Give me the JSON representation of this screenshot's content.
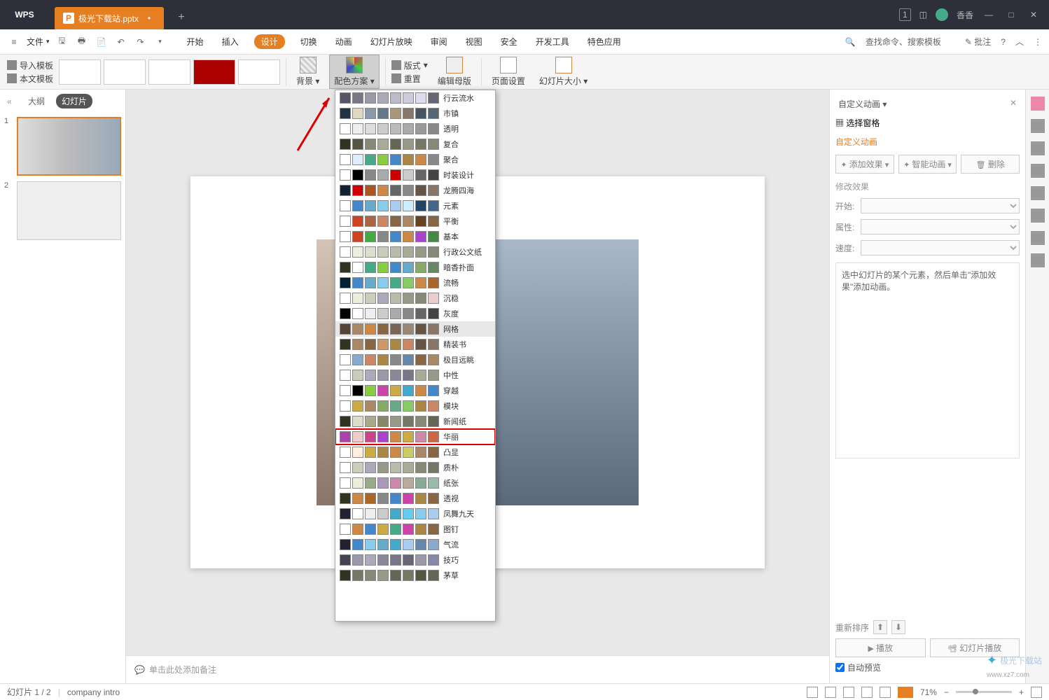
{
  "titlebar": {
    "logo": "WPS",
    "tab_icon": "P",
    "tab_name": "极光下载站.pptx",
    "plus": "+",
    "badge": "1",
    "user": "香香"
  },
  "menubar": {
    "hamburger": "≡",
    "file": "文件",
    "tabs": [
      "开始",
      "插入",
      "设计",
      "切换",
      "动画",
      "幻灯片放映",
      "审阅",
      "视图",
      "安全",
      "开发工具",
      "特色应用"
    ],
    "active_tab": "设计",
    "search": "查找命令、搜索模板",
    "批注": "批注"
  },
  "toolbar": {
    "import_template": "导入模板",
    "this_template": "本文模板",
    "background": "背景",
    "color_scheme": "配色方案",
    "layout": "版式",
    "reset": "重置",
    "edit_master": "编辑母版",
    "page_setup": "页面设置",
    "slide_size": "幻灯片大小"
  },
  "left_panel": {
    "outline": "大纲",
    "slides": "幻灯片",
    "collapse": "«"
  },
  "notes": {
    "placeholder": "单击此处添加备注"
  },
  "right_panel": {
    "title": "自定义动画",
    "select_pane": "选择窗格",
    "custom_anim": "自定义动画",
    "add_effect": "添加效果",
    "smart_anim": "智能动画",
    "delete": "删除",
    "modify": "修改效果",
    "start": "开始:",
    "property": "属性:",
    "speed": "速度:",
    "hint": "选中幻灯片的某个元素，然后单击\"添加效果\"添加动画。",
    "reorder": "重新排序",
    "play": "播放",
    "slideshow": "幻灯片播放",
    "auto_preview": "自动预览"
  },
  "statusbar": {
    "slide_info": "幻灯片 1 / 2",
    "field2": "company intro",
    "zoom": "71%"
  },
  "color_schemes": [
    {
      "name": "行云流水",
      "colors": [
        "#556",
        "#778",
        "#99a",
        "#aab",
        "#bbc",
        "#ccd",
        "#dde",
        "#667"
      ]
    },
    {
      "name": "市镇",
      "colors": [
        "#234",
        "#e0d8c0",
        "#8899aa",
        "#667788",
        "#a89878",
        "#887766",
        "#445566",
        "#556677"
      ]
    },
    {
      "name": "透明",
      "colors": [
        "#fff",
        "#eee",
        "#ddd",
        "#ccc",
        "#bbb",
        "#aaa",
        "#999",
        "#888"
      ]
    },
    {
      "name": "复合",
      "colors": [
        "#332",
        "#554",
        "#887",
        "#aa9",
        "#665",
        "#998",
        "#776",
        "#887"
      ]
    },
    {
      "name": "聚合",
      "colors": [
        "#fff",
        "#def",
        "#4a8",
        "#8c4",
        "#48c",
        "#a84",
        "#c84",
        "#888"
      ]
    },
    {
      "name": "时装设计",
      "colors": [
        "#fff",
        "#000",
        "#888",
        "#aaa",
        "#c00",
        "#ccc",
        "#666",
        "#444"
      ]
    },
    {
      "name": "龙腾四海",
      "colors": [
        "#123",
        "#c00",
        "#a52",
        "#c84",
        "#666",
        "#888",
        "#654",
        "#876"
      ]
    },
    {
      "name": "元素",
      "colors": [
        "#fff",
        "#48c",
        "#6ac",
        "#8ce",
        "#ace",
        "#cef",
        "#246",
        "#468"
      ]
    },
    {
      "name": "平衡",
      "colors": [
        "#fff",
        "#c42",
        "#a64",
        "#c86",
        "#864",
        "#a86",
        "#642",
        "#864"
      ]
    },
    {
      "name": "基本",
      "colors": [
        "#fff",
        "#c42",
        "#4a4",
        "#888",
        "#48c",
        "#c84",
        "#a4c",
        "#484"
      ]
    },
    {
      "name": "行政公文纸",
      "colors": [
        "#fff",
        "#eed",
        "#ddc",
        "#ccb",
        "#bba",
        "#aa9",
        "#998",
        "#887"
      ]
    },
    {
      "name": "暗香扑面",
      "colors": [
        "#332",
        "#fff",
        "#4a8",
        "#8c4",
        "#48c",
        "#6ac",
        "#8a6",
        "#686"
      ]
    },
    {
      "name": "流畅",
      "colors": [
        "#023",
        "#48c",
        "#6ac",
        "#8ce",
        "#4a8",
        "#8c6",
        "#c84",
        "#a62"
      ]
    },
    {
      "name": "沉稳",
      "colors": [
        "#fff",
        "#eed",
        "#ccb",
        "#aab",
        "#bba",
        "#998",
        "#887",
        "#ecc"
      ]
    },
    {
      "name": "灰度",
      "colors": [
        "#000",
        "#fff",
        "#eee",
        "#ccc",
        "#aaa",
        "#888",
        "#666",
        "#444"
      ]
    },
    {
      "name": "网格",
      "colors": [
        "#543",
        "#a86",
        "#c84",
        "#864",
        "#765",
        "#987",
        "#654",
        "#876"
      ],
      "highlighted": true
    },
    {
      "name": "精装书",
      "colors": [
        "#332",
        "#a86",
        "#864",
        "#c96",
        "#a84",
        "#c86",
        "#654",
        "#876"
      ]
    },
    {
      "name": "极目远眺",
      "colors": [
        "#fff",
        "#8ac",
        "#c86",
        "#a84",
        "#888",
        "#68a",
        "#864",
        "#a86"
      ]
    },
    {
      "name": "中性",
      "colors": [
        "#fff",
        "#ccb",
        "#aab",
        "#99a",
        "#889",
        "#778",
        "#aa9",
        "#998"
      ]
    },
    {
      "name": "穿越",
      "colors": [
        "#fff",
        "#000",
        "#8c4",
        "#c4a",
        "#ca4",
        "#4ac",
        "#c84",
        "#48c"
      ]
    },
    {
      "name": "模块",
      "colors": [
        "#fff",
        "#ca4",
        "#a86",
        "#8a6",
        "#6a8",
        "#8c6",
        "#a84",
        "#c86"
      ]
    },
    {
      "name": "新闻纸",
      "colors": [
        "#332",
        "#ddc",
        "#aa8",
        "#886",
        "#998",
        "#776",
        "#887",
        "#665"
      ]
    },
    {
      "name": "华丽",
      "colors": [
        "#a4a",
        "#ecc",
        "#c48",
        "#a4c",
        "#c84",
        "#ca4",
        "#c8a",
        "#c64"
      ],
      "red_box": true
    },
    {
      "name": "凸显",
      "colors": [
        "#fff",
        "#fed",
        "#ca4",
        "#a84",
        "#c84",
        "#cc6",
        "#a86",
        "#864"
      ]
    },
    {
      "name": "质朴",
      "colors": [
        "#fff",
        "#ccb",
        "#aab",
        "#998",
        "#bba",
        "#aa9",
        "#887",
        "#776"
      ]
    },
    {
      "name": "纸张",
      "colors": [
        "#fff",
        "#eed",
        "#9a8",
        "#a9b",
        "#c8a",
        "#ba9",
        "#8a9",
        "#9ba"
      ]
    },
    {
      "name": "透视",
      "colors": [
        "#332",
        "#c84",
        "#a62",
        "#888",
        "#48c",
        "#c4a",
        "#a84",
        "#864"
      ]
    },
    {
      "name": "凤舞九天",
      "colors": [
        "#223",
        "#fff",
        "#eee",
        "#ccc",
        "#4ac",
        "#6ce",
        "#8ce",
        "#ace"
      ]
    },
    {
      "name": "图钉",
      "colors": [
        "#fff",
        "#c84",
        "#48c",
        "#ca4",
        "#4a8",
        "#c4a",
        "#a84",
        "#864"
      ]
    },
    {
      "name": "气流",
      "colors": [
        "#223",
        "#48c",
        "#8ce",
        "#6ac",
        "#4ac",
        "#ace",
        "#68a",
        "#8ac"
      ]
    },
    {
      "name": "技巧",
      "colors": [
        "#445",
        "#99a",
        "#aab",
        "#889",
        "#778",
        "#667",
        "#99a",
        "#88a"
      ]
    },
    {
      "name": "茅草",
      "colors": [
        "#332",
        "#776",
        "#887",
        "#998",
        "#665",
        "#776",
        "#554",
        "#665"
      ]
    }
  ],
  "watermark": "极光下载站"
}
